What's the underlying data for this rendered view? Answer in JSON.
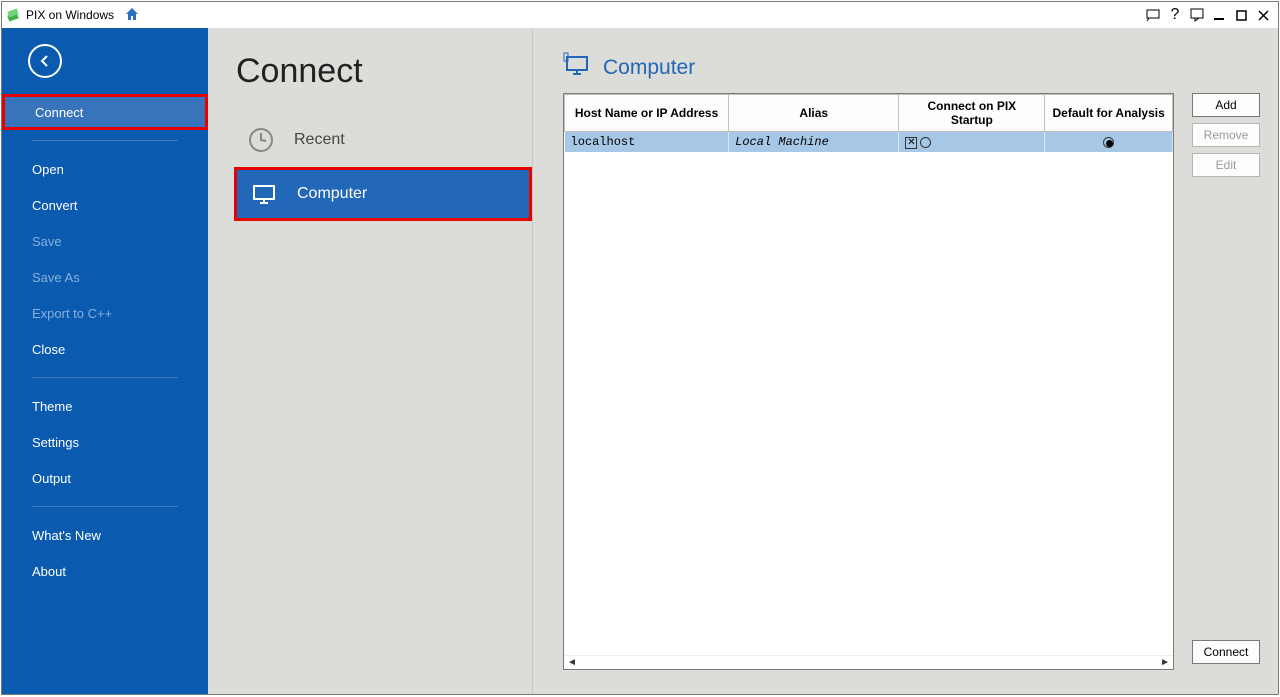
{
  "titlebar": {
    "app_name": "PIX on Windows"
  },
  "sidebar": {
    "connect": "Connect",
    "open": "Open",
    "convert": "Convert",
    "save": "Save",
    "save_as": "Save As",
    "export": "Export to C++",
    "close": "Close",
    "theme": "Theme",
    "settings": "Settings",
    "output": "Output",
    "whats_new": "What's New",
    "about": "About"
  },
  "main": {
    "page_title": "Connect",
    "recent": "Recent",
    "computer": "Computer"
  },
  "panel": {
    "title": "Computer",
    "columns": {
      "host": "Host Name or IP Address",
      "alias": "Alias",
      "connect_on_startup": "Connect on PIX Startup",
      "default_analysis": "Default for Analysis"
    },
    "rows": [
      {
        "host": "localhost",
        "alias": "Local Machine",
        "connect_checked": true,
        "default_checked": true
      }
    ],
    "buttons": {
      "add": "Add",
      "remove": "Remove",
      "edit": "Edit",
      "connect": "Connect"
    }
  }
}
